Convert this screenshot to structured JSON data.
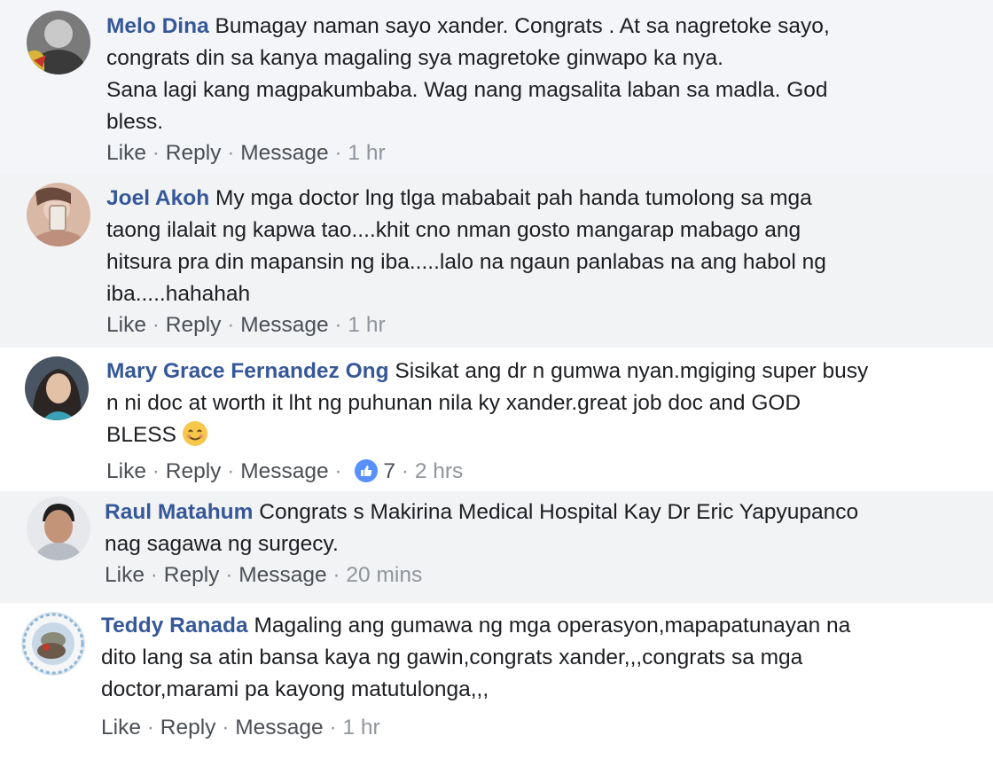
{
  "comments": [
    {
      "author": "Melo Dina",
      "lines": [
        "Bumagay naman sayo xander. Congrats . At sa nagretoke sayo,",
        "congrats din sa kanya magaling sya magretoke ginwapo ka nya.",
        "Sana lagi kang magpakumbaba. Wag nang magsalita laban sa madla. God",
        "bless."
      ],
      "actions": {
        "like": "Like",
        "reply": "Reply",
        "message": "Message",
        "sep": "·",
        "time": "1 hr"
      }
    },
    {
      "author": "Joel Akoh",
      "lines": [
        "My mga doctor lng tlga mababait pah handa tumolong sa mga",
        "taong ilalait ng kapwa tao....khit cno nman gosto mangarap mabago ang",
        "hitsura pra din mapansin ng iba.....lalo na ngaun panlabas na ang habol ng",
        "iba.....hahahah"
      ],
      "actions": {
        "like": "Like",
        "reply": "Reply",
        "message": "Message",
        "sep": "·",
        "time": "1 hr"
      }
    },
    {
      "author": "Mary Grace Fernandez Ong",
      "lines": [
        "Sisikat ang dr n gumwa nyan.mgiging super busy",
        "n ni doc at worth it lht ng puhunan nila ky xander.great job doc and GOD",
        "BLESS"
      ],
      "emoji": "smiling-face-emoji",
      "actions": {
        "like": "Like",
        "reply": "Reply",
        "message": "Message",
        "sep": "·",
        "reaction_icon": "thumbs-up-icon",
        "reaction_count": "7",
        "time": "2 hrs"
      }
    },
    {
      "author": "Raul Matahum",
      "lines": [
        "Congrats s Makirina Medical Hospital Kay Dr Eric Yapyupanco",
        "nag sagawa ng surgecy."
      ],
      "actions": {
        "like": "Like",
        "reply": "Reply",
        "message": "Message",
        "sep": "·",
        "time": "20 mins"
      }
    },
    {
      "author": "Teddy Ranada",
      "lines": [
        "Magaling ang gumawa ng mga operasyon,mapapatunayan na",
        "dito lang sa atin bansa kaya ng gawin,congrats xander,,,congrats sa mga",
        "doctor,marami pa kayong matutulonga,,,"
      ],
      "actions": {
        "like": "Like",
        "reply": "Reply",
        "message": "Message",
        "sep": "·",
        "time": "1 hr"
      }
    }
  ],
  "colors": {
    "name": "#365899",
    "text": "#1c1e21",
    "meta": "#90949c",
    "reaction": "#5890ff"
  }
}
